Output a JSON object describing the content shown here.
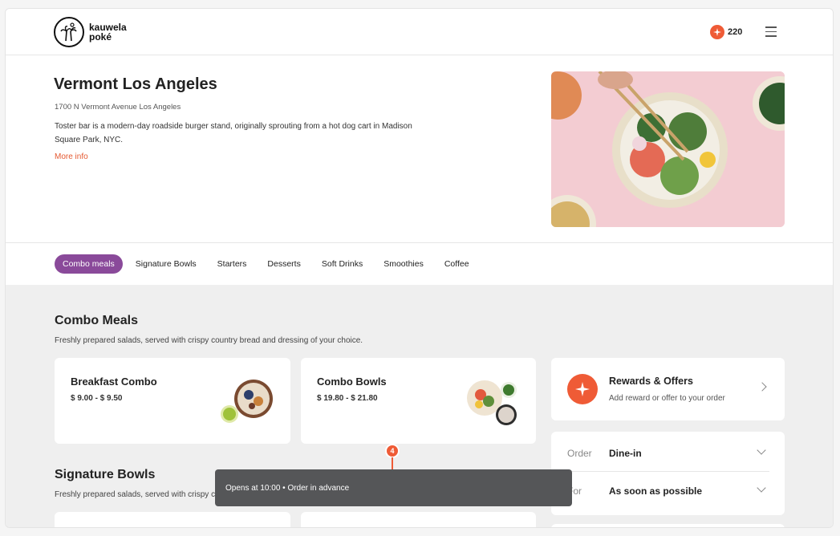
{
  "brand": {
    "name_line1": "kauwela",
    "name_line2": "poké"
  },
  "header": {
    "points": "220"
  },
  "store": {
    "name": "Vermont Los Angeles",
    "address": "1700 N Vermont Avenue Los Angeles",
    "description": "Toster bar is a modern-day roadside burger stand, originally sprouting from a hot dog cart in Madison Square Park, NYC.",
    "more_info": "More info"
  },
  "tabs": [
    {
      "label": "Combo meals",
      "active": true
    },
    {
      "label": "Signature Bowls"
    },
    {
      "label": "Starters"
    },
    {
      "label": "Desserts"
    },
    {
      "label": "Soft Drinks"
    },
    {
      "label": "Smoothies"
    },
    {
      "label": "Coffee"
    }
  ],
  "sections": {
    "combo": {
      "title": "Combo Meals",
      "subtitle": "Freshly prepared salads, served with crispy country bread and dressing of your choice."
    },
    "signature": {
      "title": "Signature Bowls",
      "subtitle": "Freshly prepared salads, served with crispy country bread and dressing of your choice."
    }
  },
  "products": [
    {
      "title": "Breakfast Combo",
      "price": "$ 9.00 - $ 9.50"
    },
    {
      "title": "Combo Bowls",
      "price": "$ 19.80 - $ 21.80"
    }
  ],
  "rewards": {
    "title": "Rewards & Offers",
    "subtitle": "Add reward or offer to your order"
  },
  "order": {
    "type_label": "Order",
    "type_value": "Dine-in",
    "time_label": "For",
    "time_value": "As soon as possible"
  },
  "toast": {
    "text": "Opens at 10:00 • Order in advance"
  },
  "step_marker": "4",
  "colors": {
    "accent": "#ef5b36",
    "tab_active": "#8a4a9a"
  }
}
